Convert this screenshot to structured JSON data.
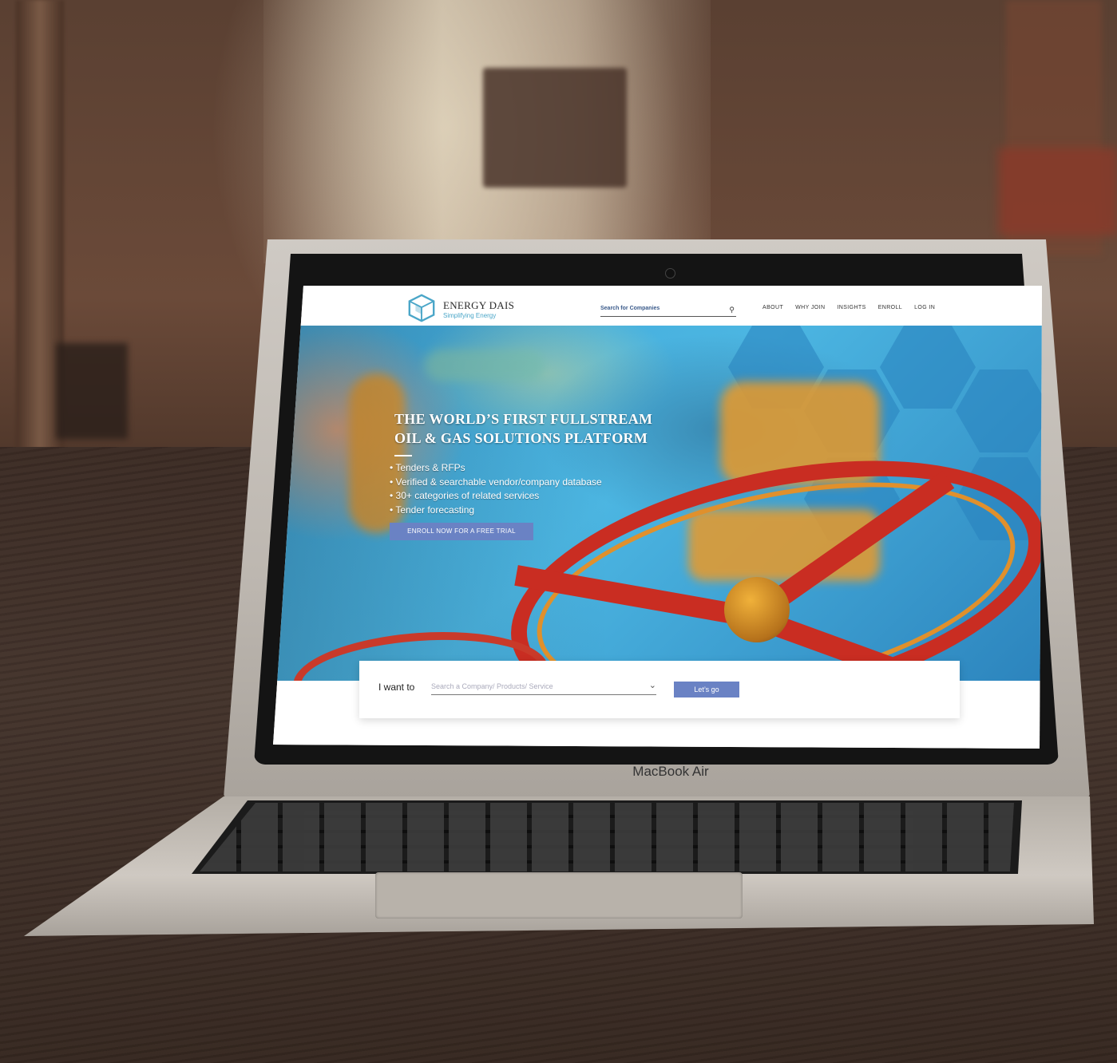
{
  "device": {
    "model_label": "MacBook Air"
  },
  "site": {
    "logo": {
      "title": "ENERGY DAIS",
      "tagline": "Simplifying Energy",
      "icon": "cube-logo-icon"
    },
    "header_search": {
      "placeholder": "Search for Companies",
      "icon": "search-icon"
    },
    "nav": [
      {
        "label": "ABOUT"
      },
      {
        "label": "WHY JOIN"
      },
      {
        "label": "INSIGHTS"
      },
      {
        "label": "ENROLL"
      },
      {
        "label": "LOG IN"
      }
    ],
    "hero": {
      "headline_line1": "THE WORLD’S FIRST FULLSTREAM",
      "headline_line2": "OIL & GAS SOLUTIONS PLATFORM",
      "bullets": [
        "• Tenders & RFPs",
        "• Verified & searchable vendor/company database",
        "• 30+ categories of related services",
        "• Tender forecasting"
      ],
      "cta_label": "ENROLL NOW FOR A FREE TRIAL"
    },
    "want": {
      "label": "I want to",
      "placeholder": "Search a Company/ Products/ Service",
      "dropdown_icon": "chevron-down-icon",
      "button_label": "Let’s go"
    }
  },
  "colors": {
    "accent": "#6a82c4",
    "logo_blue": "#4aa6c8",
    "wheel_red": "#c92d22"
  }
}
